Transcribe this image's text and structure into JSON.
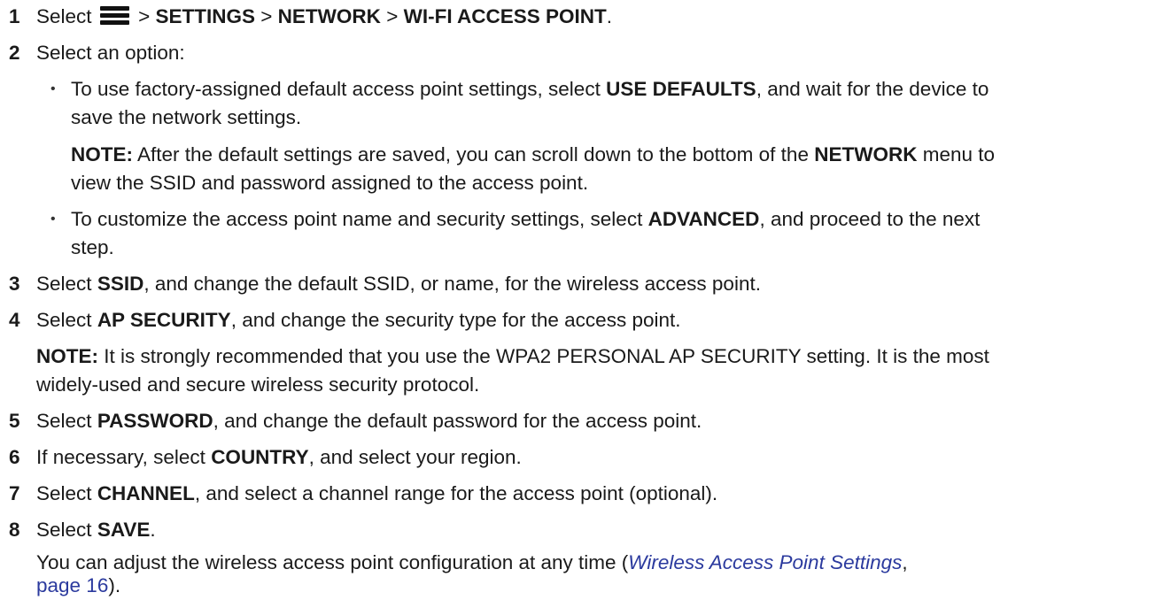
{
  "steps": [
    {
      "num": "1",
      "select": "Select",
      "sep": ">",
      "menu1": "SETTINGS",
      "menu2": "NETWORK",
      "menu3": "WI-FI ACCESS POINT",
      "end": "."
    },
    {
      "num": "2",
      "text": "Select an option:"
    },
    {
      "num": "3",
      "pre": "Select",
      "bold": "SSID",
      "post": ", and change the default SSID, or name, for the wireless access point."
    },
    {
      "num": "4",
      "pre": "Select",
      "bold": "AP SECURITY",
      "post": ", and change the security type for the access point."
    },
    {
      "num": "5",
      "pre": "Select",
      "bold": "PASSWORD",
      "post": ", and change the default password for the access point."
    },
    {
      "num": "6",
      "pre": "If necessary, select",
      "bold": "COUNTRY",
      "post": ", and select your region."
    },
    {
      "num": "7",
      "pre": "Select",
      "bold": "CHANNEL",
      "post": ", and select a channel range for the access point (optional)."
    },
    {
      "num": "8",
      "pre": "Select",
      "bold": "SAVE",
      "post": "."
    }
  ],
  "options": [
    {
      "l1_pre": "To use factory-assigned default access point settings, select",
      "l1_bold": "USE DEFAULTS",
      "l1_post": ", and wait for the device to",
      "l2": "save the network settings."
    },
    {
      "l1_pre": "To customize the access point name and security settings, select",
      "l1_bold": "ADVANCED",
      "l1_post": ", and proceed to the next",
      "l2": "step."
    }
  ],
  "note1": {
    "label": "NOTE:",
    "l1_pre": "After the default settings are saved, you can scroll down to the bottom of the",
    "l1_bold": "NETWORK",
    "l1_post": "menu to",
    "l2": "view the SSID and password assigned to the access point."
  },
  "note2": {
    "label": "NOTE:",
    "l1": "It is strongly recommended that you use the WPA2 PERSONAL AP SECURITY setting. It is the most",
    "l2": "widely-used and secure wireless security protocol."
  },
  "footer": {
    "l1_pre": "You can adjust the wireless access point configuration at any time (",
    "link_text": "Wireless Access Point Settings",
    "comma": ",",
    "page_text": "page 16",
    "close": ")."
  }
}
